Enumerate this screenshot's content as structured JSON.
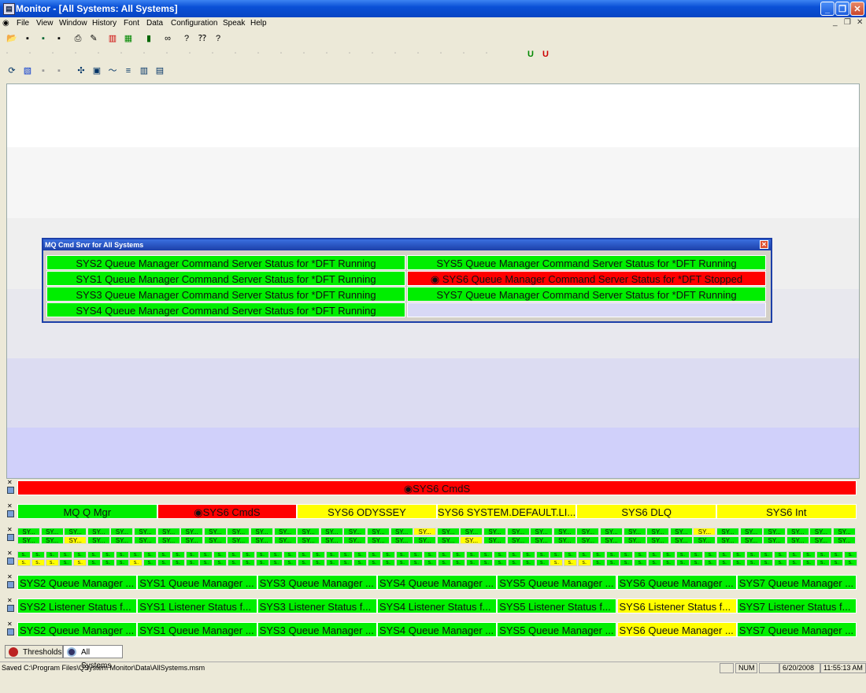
{
  "window": {
    "title": "Monitor - [All Systems: All Systems]",
    "icon": "monitor-app-icon"
  },
  "menu": [
    "File",
    "View",
    "Window",
    "History",
    "Font",
    "Data",
    "Configuration",
    "Speak",
    "Help"
  ],
  "popup": {
    "title": "MQ Cmd Srvr for All Systems",
    "left": [
      {
        "text": "SYS2 Queue Manager Command Server Status for *DFT Running",
        "status": "green"
      },
      {
        "text": "SYS1 Queue Manager Command Server Status for *DFT Running",
        "status": "green"
      },
      {
        "text": "SYS3 Queue Manager Command Server Status for *DFT Running",
        "status": "green"
      },
      {
        "text": "SYS4 Queue Manager Command Server Status for *DFT Running",
        "status": "green"
      }
    ],
    "right": [
      {
        "text": "SYS5 Queue Manager Command Server Status for *DFT Running",
        "status": "green"
      },
      {
        "text": "SYS6 Queue Manager Command Server Status for *DFT Stopped",
        "status": "red"
      },
      {
        "text": "SYS7 Queue Manager Command Server Status for *DFT Running",
        "status": "green"
      }
    ]
  },
  "rows": {
    "row1": [
      {
        "text": "SYS6 CmdS",
        "status": "red"
      }
    ],
    "row2": [
      {
        "text": "MQ Q Mgr",
        "status": "green"
      },
      {
        "text": "SYS6 CmdS",
        "status": "red"
      },
      {
        "text": "SYS6 ODYSSEY",
        "status": "yellow"
      },
      {
        "text": "SYS6 SYSTEM.DEFAULT.LI...",
        "status": "yellow"
      },
      {
        "text": "SYS6 DLQ",
        "status": "yellow"
      },
      {
        "text": "SYS6 Int",
        "status": "yellow"
      }
    ],
    "row5": [
      {
        "text": "SYS2 Queue Manager ...",
        "status": "green"
      },
      {
        "text": "SYS1 Queue Manager ...",
        "status": "green"
      },
      {
        "text": "SYS3 Queue Manager ...",
        "status": "green"
      },
      {
        "text": "SYS4 Queue Manager ...",
        "status": "green"
      },
      {
        "text": "SYS5 Queue Manager ...",
        "status": "green"
      },
      {
        "text": "SYS6 Queue Manager ...",
        "status": "green"
      },
      {
        "text": "SYS7 Queue Manager ...",
        "status": "green"
      }
    ],
    "row6": [
      {
        "text": "SYS2 Listener Status f...",
        "status": "green"
      },
      {
        "text": "SYS1 Listener Status f...",
        "status": "green"
      },
      {
        "text": "SYS3 Listener Status f...",
        "status": "green"
      },
      {
        "text": "SYS4 Listener Status f...",
        "status": "green"
      },
      {
        "text": "SYS5 Listener Status f...",
        "status": "green"
      },
      {
        "text": "SYS6 Listener Status f...",
        "status": "yellow"
      },
      {
        "text": "SYS7 Listener Status f...",
        "status": "green"
      }
    ],
    "row7": [
      {
        "text": "SYS2 Queue Manager ...",
        "status": "green"
      },
      {
        "text": "SYS1 Queue Manager ...",
        "status": "green"
      },
      {
        "text": "SYS3 Queue Manager ...",
        "status": "green"
      },
      {
        "text": "SYS4 Queue Manager ...",
        "status": "green"
      },
      {
        "text": "SYS5 Queue Manager ...",
        "status": "green"
      },
      {
        "text": "SYS6 Queue Manager ...",
        "status": "yellow"
      },
      {
        "text": "SYS7 Queue Manager ...",
        "status": "green"
      }
    ]
  },
  "tabs": [
    {
      "label": "Thresholds",
      "icon": "thresholds-icon"
    },
    {
      "label": "All Systems",
      "icon": "globe-icon"
    }
  ],
  "status": {
    "message": "Saved C:\\Program Files\\QSystem Monitor\\Data\\AllSystems.msm",
    "num": "NUM",
    "date": "6/20/2008",
    "time": "11:55:13 AM"
  },
  "colors": {
    "green": "#00ee00",
    "red": "#ff0000",
    "yellow": "#ffff00",
    "accent": "#0a50d6"
  }
}
